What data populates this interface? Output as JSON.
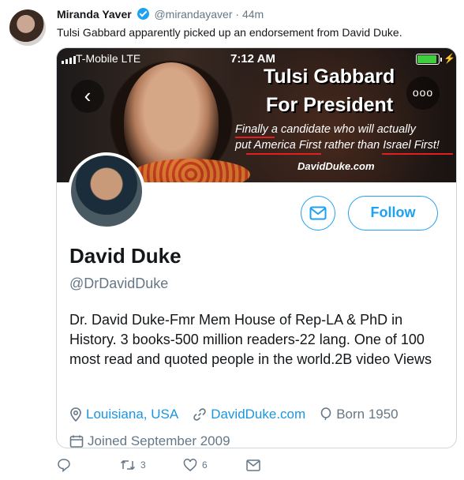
{
  "tweet": {
    "author_name": "Miranda Yaver",
    "author_handle": "@mirandayaver",
    "time": "44m",
    "text": "Tulsi Gabbard apparently picked up an endorsement from David Duke."
  },
  "screenshot": {
    "status_bar": {
      "carrier": "T-Mobile  LTE",
      "time": "7:12 AM"
    },
    "banner": {
      "headline_1": "Tulsi Gabbard",
      "headline_2": "For President",
      "sub_1": "Finally a candidate who will actually",
      "sub_2": "put America First rather than Israel First!",
      "site": "DavidDuke.com"
    },
    "profile": {
      "follow_label": "Follow",
      "name": "David Duke",
      "handle": "@DrDavidDuke",
      "bio": "Dr. David Duke-Fmr Mem House of Rep-LA & PhD in History. 3 books-500 million readers-22 lang. One of 100 most read and quoted people in the world.2B video Views",
      "location": "Louisiana, USA",
      "website": "DavidDuke.com",
      "born": "Born 1950",
      "joined": "Joined September 2009"
    }
  },
  "actions": {
    "retweets": "3",
    "likes": "6"
  },
  "colors": {
    "accent": "#1da1f2",
    "link": "#1b95e0",
    "muted": "#657786",
    "battery": "#3ecf3e",
    "underline": "#e02020"
  }
}
